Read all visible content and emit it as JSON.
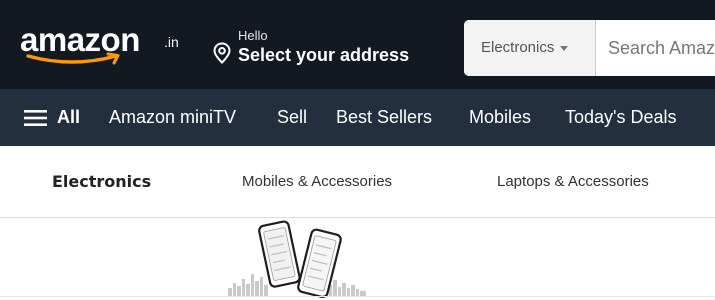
{
  "header": {
    "logo_text": "amazon",
    "logo_tld": ".in",
    "hello": "Hello",
    "select_address": "Select your address",
    "search": {
      "category": "Electronics",
      "placeholder": "Search Amazon.in"
    }
  },
  "subnav": {
    "items": [
      "All",
      "Amazon miniTV",
      "Sell",
      "Best Sellers",
      "Mobiles",
      "Today's Deals"
    ]
  },
  "category_bar": {
    "title": "Electronics",
    "items": [
      "Mobiles & Accessories",
      "Laptops & Accessories"
    ]
  },
  "colors": {
    "nav_bg": "#131921",
    "subnav_bg": "#232f3e",
    "logo_smile": "#ff9900"
  },
  "icons": [
    "location-pin-icon",
    "hamburger-menu-icon",
    "dropdown-caret-icon"
  ]
}
